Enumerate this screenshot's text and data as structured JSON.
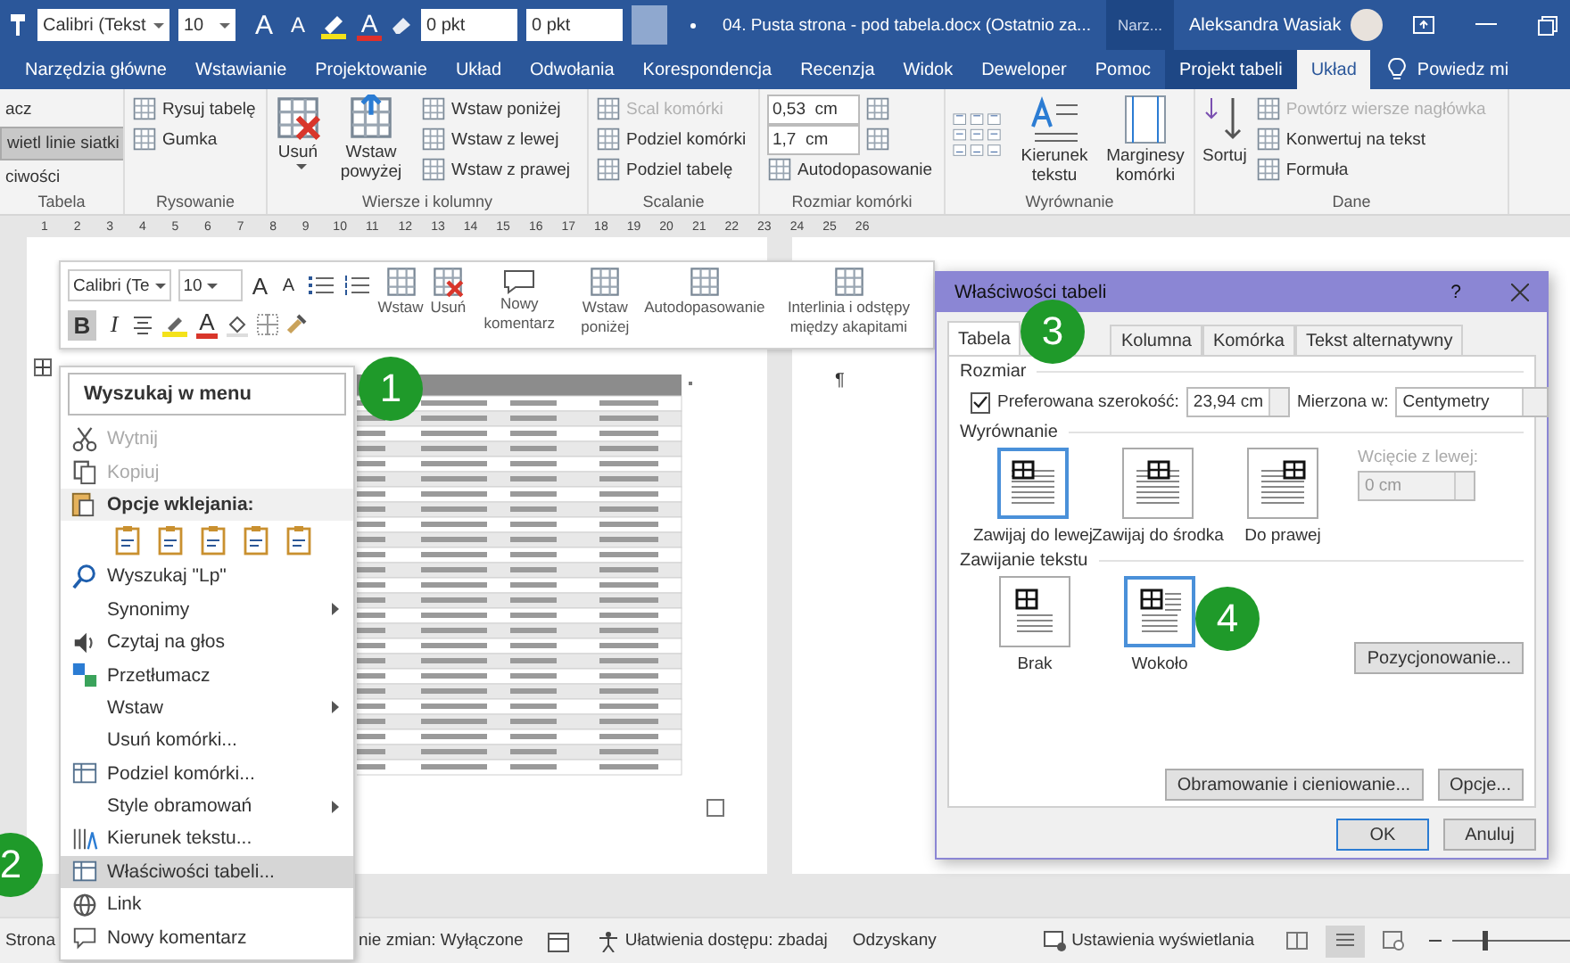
{
  "title_bar": {
    "font": "Calibri (Tekst",
    "size": "10",
    "grow_font": "A",
    "shrink_font": "A",
    "font_color": "A",
    "spacing_before": "0 pkt",
    "spacing_after": "0 pkt",
    "title": "04. Pusta strona - pod tabela.docx (Ostatnio za...",
    "context_label": "Narz...",
    "user": "Aleksandra Wasiak"
  },
  "tabs": [
    {
      "label": "Narzędzia główne",
      "selected": false
    },
    {
      "label": "Wstawianie",
      "selected": false
    },
    {
      "label": "Projektowanie",
      "selected": false
    },
    {
      "label": "Układ",
      "selected": false
    },
    {
      "label": "Odwołania",
      "selected": false
    },
    {
      "label": "Korespondencja",
      "selected": false
    },
    {
      "label": "Recenzja",
      "selected": false
    },
    {
      "label": "Widok",
      "selected": false
    },
    {
      "label": "Deweloper",
      "selected": false
    },
    {
      "label": "Pomoc",
      "selected": false
    },
    {
      "label": "Projekt tabeli",
      "selected": false
    },
    {
      "label": "Układ",
      "selected": true
    }
  ],
  "tell_me": "Powiedz mi",
  "ribbon": {
    "table": {
      "label": "Tabela",
      "items": [
        {
          "label": "acz",
          "selected": false
        },
        {
          "label": "wietl linie siatki",
          "selected": true
        },
        {
          "label": "ciwości",
          "selected": false
        }
      ]
    },
    "drawing": {
      "label": "Rysowanie",
      "items": [
        "Rysuj tabelę",
        "Gumka"
      ]
    },
    "rows_columns": {
      "label": "Wiersze i kolumny",
      "delete": "Usuń",
      "insert_above": "Wstaw powyżej",
      "items": [
        "Wstaw poniżej",
        "Wstaw z lewej",
        "Wstaw z prawej"
      ]
    },
    "merge": {
      "label": "Scalanie",
      "items": [
        {
          "label": "Scal komórki",
          "disabled": true
        },
        {
          "label": "Podziel komórki",
          "disabled": false
        },
        {
          "label": "Podziel tabelę",
          "disabled": false
        }
      ]
    },
    "cell_size": {
      "label": "Rozmiar komórki",
      "height": "0,53  cm",
      "width": "1,7  cm",
      "autofit": "Autodopasowanie"
    },
    "alignment": {
      "label": "Wyrównanie",
      "text_direction": "Kierunek tekstu",
      "margins": "Marginesy komórki"
    },
    "data": {
      "label": "Dane",
      "sort": "Sortuj",
      "items": [
        {
          "label": "Powtórz wiersze nagłówka",
          "disabled": true
        },
        {
          "label": "Konwertuj na tekst",
          "disabled": false
        },
        {
          "label": "Formuła",
          "disabled": false
        }
      ]
    }
  },
  "ruler": [
    "1",
    "2",
    "3",
    "4",
    "5",
    "6",
    "7",
    "8",
    "9",
    "10",
    "11",
    "12",
    "13",
    "14",
    "15",
    "16",
    "17",
    "18",
    "19",
    "20",
    "21",
    "22",
    "23",
    "24",
    "25",
    "26"
  ],
  "mini_toolbar": {
    "font": "Calibri (Te",
    "size": "10",
    "grow_font": "A",
    "shrink_font": "A",
    "bold": {
      "label": "B",
      "selected": true
    },
    "italic": "I",
    "font_color": "A",
    "buttons": [
      "Wstaw",
      "Usuń",
      "Nowy komentarz",
      "Wstaw poniżej",
      "Autodopasowanie",
      "Interlinia i odstępy między akapitami"
    ]
  },
  "context_menu": {
    "search": {
      "placeholder": "Wyszukaj w menu"
    },
    "items": [
      {
        "kind": "item",
        "label": "Wytnij",
        "disabled": true,
        "submenu": false,
        "selected": false
      },
      {
        "kind": "item",
        "label": "Kopiuj",
        "disabled": true,
        "submenu": false,
        "selected": false
      },
      {
        "kind": "header",
        "label": "Opcje wklejania:"
      },
      {
        "kind": "item",
        "label": "Wyszukaj \"Lp\"",
        "disabled": false,
        "submenu": false,
        "selected": false
      },
      {
        "kind": "item",
        "label": "Synonimy",
        "disabled": false,
        "submenu": true,
        "selected": false
      },
      {
        "kind": "item",
        "label": "Czytaj na głos",
        "disabled": false,
        "submenu": false,
        "selected": false
      },
      {
        "kind": "item",
        "label": "Przetłumacz",
        "disabled": false,
        "submenu": false,
        "selected": false
      },
      {
        "kind": "item",
        "label": "Wstaw",
        "disabled": false,
        "submenu": true,
        "selected": false
      },
      {
        "kind": "item",
        "label": "Usuń komórki...",
        "disabled": false,
        "submenu": false,
        "selected": false
      },
      {
        "kind": "item",
        "label": "Podziel komórki...",
        "disabled": false,
        "submenu": false,
        "selected": false
      },
      {
        "kind": "item",
        "label": "Style obramowań",
        "disabled": false,
        "submenu": true,
        "selected": false
      },
      {
        "kind": "item",
        "label": "Kierunek tekstu...",
        "disabled": false,
        "submenu": false,
        "selected": false
      },
      {
        "kind": "item",
        "label": "Właściwości tabeli...",
        "disabled": false,
        "submenu": false,
        "selected": true
      },
      {
        "kind": "item",
        "label": "Link",
        "disabled": false,
        "submenu": false,
        "selected": false
      },
      {
        "kind": "item",
        "label": "Nowy komentarz",
        "disabled": false,
        "submenu": false,
        "selected": false
      }
    ]
  },
  "document": {
    "pilcrow": "¶"
  },
  "dialog": {
    "title": "Właściwości tabeli",
    "help": "?",
    "tabs": [
      {
        "label": "Tabela",
        "selected": true
      },
      {
        "label": "Kolumna",
        "selected": false
      },
      {
        "label": "Komórka",
        "selected": false
      },
      {
        "label": "Tekst alternatywny",
        "selected": false
      }
    ],
    "size": {
      "label": "Rozmiar",
      "preferred": {
        "label": "Preferowana szerokość:",
        "checked": true,
        "value": "23,94 cm"
      },
      "measure_label": "Mierzona w:",
      "measure": "Centymetry"
    },
    "alignment": {
      "label": "Wyrównanie",
      "options": [
        {
          "label": "Zawijaj do lewej",
          "selected": true
        },
        {
          "label": "Zawijaj do środka",
          "selected": false
        },
        {
          "label": "Do prawej",
          "selected": false
        }
      ],
      "indent": {
        "label": "Wcięcie z lewej:",
        "value": "0 cm",
        "disabled": true
      }
    },
    "wrapping": {
      "label": "Zawijanie tekstu",
      "options": [
        {
          "label": "Brak",
          "selected": false
        },
        {
          "label": "Wokoło",
          "selected": true
        }
      ]
    },
    "buttons": {
      "positioning": "Pozycjonowanie...",
      "borders": "Obramowanie i cieniowanie...",
      "options": "Opcje...",
      "ok": "OK",
      "cancel": "Anuluj"
    }
  },
  "badges": [
    "1",
    "2",
    "3",
    "4"
  ],
  "status_bar": {
    "page": "Strona",
    "track_changes": "nie zmian: Wyłączone",
    "accessibility": "Ułatwienia dostępu: zbadaj",
    "recovered": "Odzyskany",
    "display_settings": "Ustawienia wyświetlania",
    "zoom": {
      "level": 0.25
    }
  }
}
